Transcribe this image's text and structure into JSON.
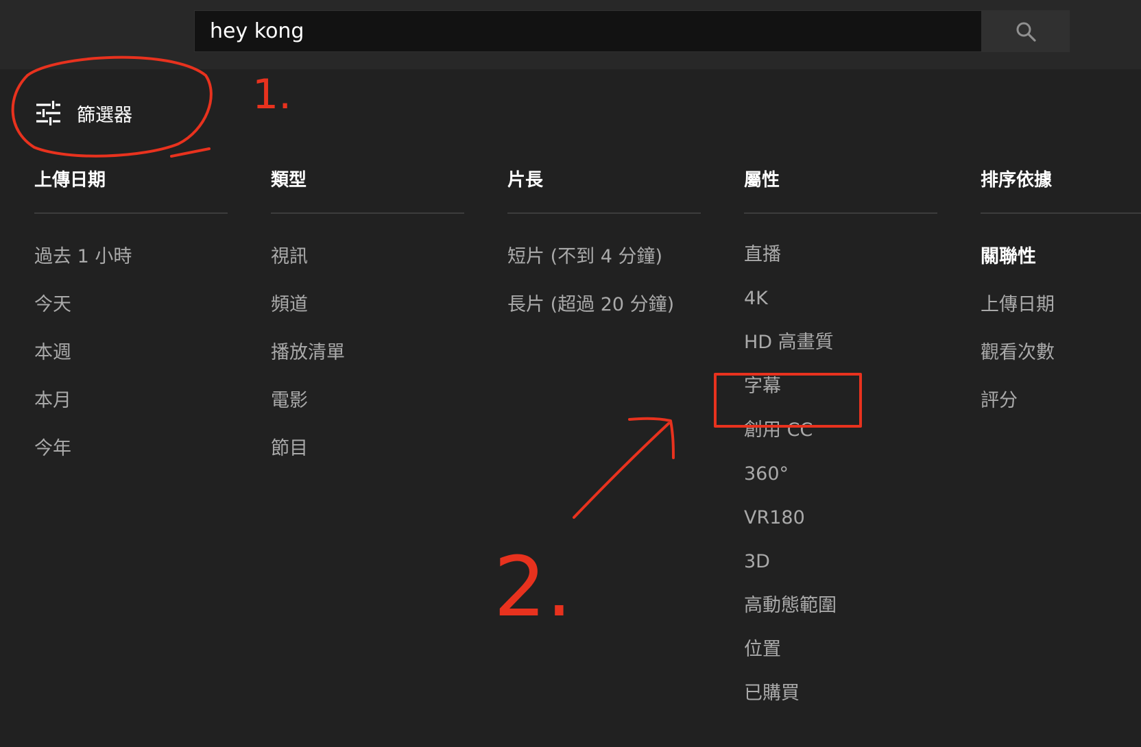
{
  "search": {
    "query": "hey kong",
    "button_icon": "search-icon"
  },
  "filters_toggle": {
    "icon": "sliders-icon",
    "label": "篩選器"
  },
  "filter_groups": [
    {
      "header": "上傳日期",
      "options": [
        {
          "label": "過去 1 小時"
        },
        {
          "label": "今天"
        },
        {
          "label": "本週"
        },
        {
          "label": "本月"
        },
        {
          "label": "今年"
        }
      ]
    },
    {
      "header": "類型",
      "options": [
        {
          "label": "視訊"
        },
        {
          "label": "頻道"
        },
        {
          "label": "播放清單"
        },
        {
          "label": "電影"
        },
        {
          "label": "節目"
        }
      ]
    },
    {
      "header": "片長",
      "options": [
        {
          "label": "短片 (不到 4 分鐘)"
        },
        {
          "label": "長片 (超過 20 分鐘)"
        }
      ]
    },
    {
      "header": "屬性",
      "options": [
        {
          "label": "直播"
        },
        {
          "label": "4K"
        },
        {
          "label": "HD 高畫質"
        },
        {
          "label": "字幕"
        },
        {
          "label": "創用 CC"
        },
        {
          "label": "360°"
        },
        {
          "label": "VR180"
        },
        {
          "label": "3D"
        },
        {
          "label": "高動態範圍"
        },
        {
          "label": "位置"
        },
        {
          "label": "已購買"
        }
      ]
    },
    {
      "header": "排序依據",
      "options": [
        {
          "label": "關聯性",
          "selected": true
        },
        {
          "label": "上傳日期"
        },
        {
          "label": "觀看次數"
        },
        {
          "label": "評分"
        }
      ]
    }
  ],
  "annotations": {
    "step1": "1.",
    "step2": "2.",
    "color": "#e8321e"
  },
  "colors": {
    "background": "#212121",
    "topbar": "#282828",
    "search_field": "#121212",
    "option_text": "#aaaaaa",
    "header_text": "#ffffff"
  }
}
